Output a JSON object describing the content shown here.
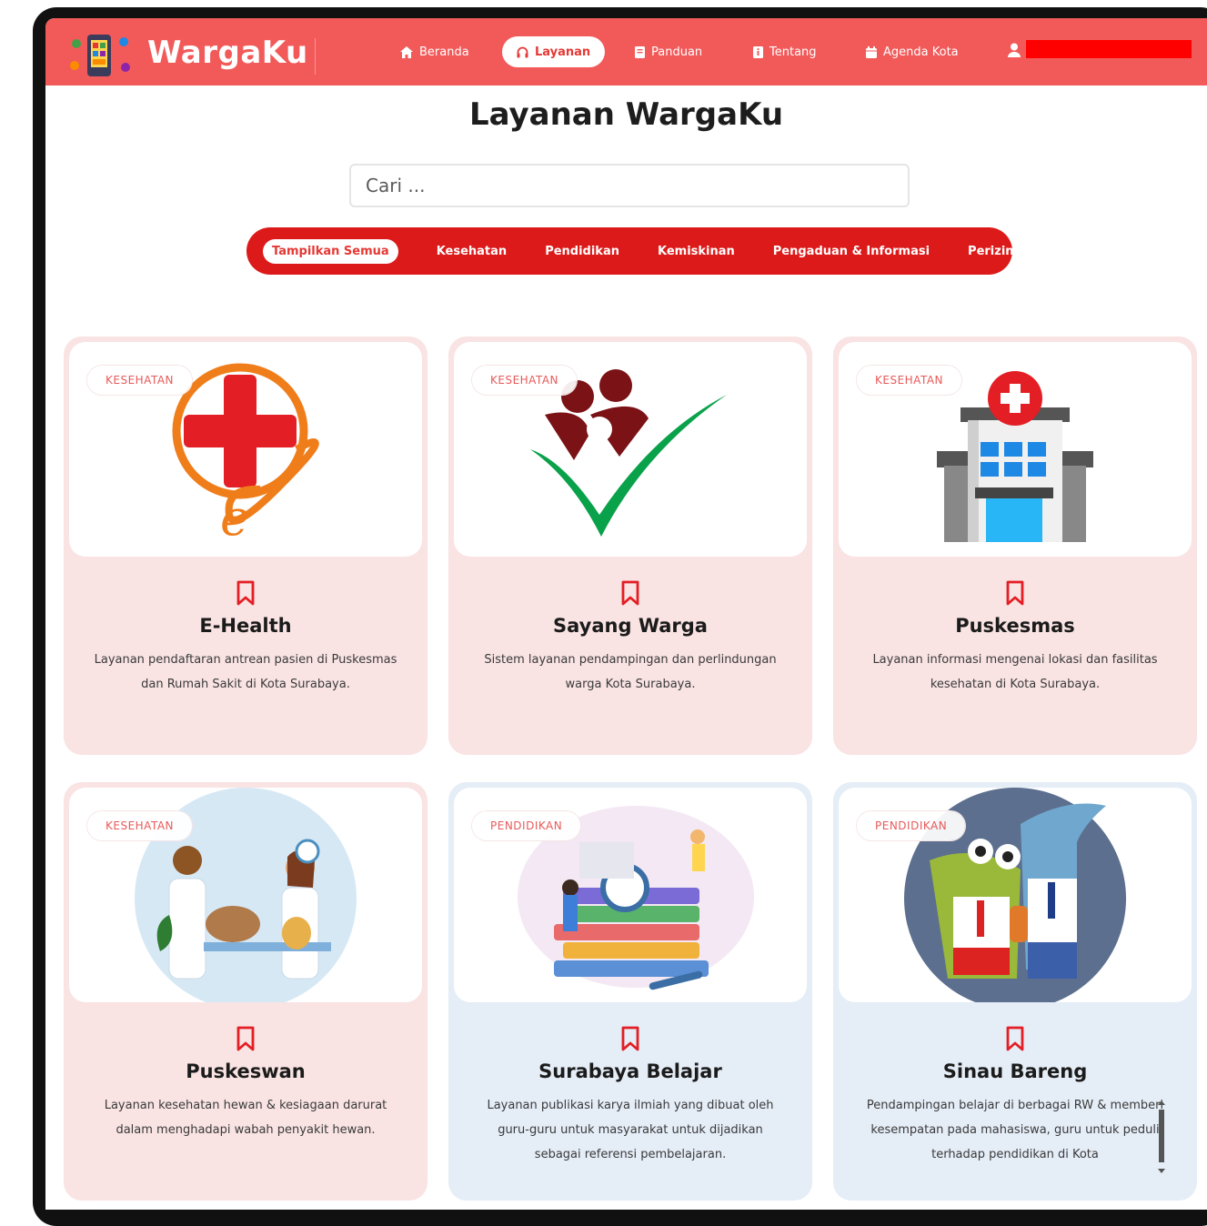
{
  "nav": {
    "brand": "WargaKu",
    "items": [
      {
        "label": "Beranda",
        "icon": "home-icon"
      },
      {
        "label": "Layanan",
        "icon": "headset-icon",
        "active": true
      },
      {
        "label": "Panduan",
        "icon": "book-icon"
      },
      {
        "label": "Tentang",
        "icon": "info-book-icon"
      },
      {
        "label": "Agenda Kota",
        "icon": "calendar-icon"
      }
    ]
  },
  "page": {
    "title": "Layanan WargaKu",
    "search_placeholder": "Cari ..."
  },
  "filters": [
    "Tampilkan Semua",
    "Kesehatan",
    "Pendidikan",
    "Kemiskinan",
    "Pengaduan & Informasi",
    "Perizinan"
  ],
  "cards": [
    {
      "badge": "KESEHATAN",
      "title": "E-Health",
      "desc": "Layanan pendaftaran antrean pasien di Puskesmas dan Rumah Sakit di Kota Surabaya."
    },
    {
      "badge": "KESEHATAN",
      "title": "Sayang Warga",
      "desc": "Sistem layanan pendampingan dan perlindungan warga Kota Surabaya."
    },
    {
      "badge": "KESEHATAN",
      "title": "Puskesmas",
      "desc": "Layanan informasi mengenai lokasi dan fasilitas kesehatan di Kota Surabaya."
    },
    {
      "badge": "KESEHATAN",
      "title": "Puskeswan",
      "desc": "Layanan kesehatan hewan & kesiagaan darurat dalam menghadapi wabah penyakit hewan."
    },
    {
      "badge": "PENDIDIKAN",
      "title": "Surabaya Belajar",
      "desc": "Layanan publikasi karya ilmiah yang dibuat oleh guru-guru untuk masyarakat untuk dijadikan sebagai referensi pembelajaran."
    },
    {
      "badge": "PENDIDIKAN",
      "title": "Sinau Bareng",
      "desc": "Pendampingan belajar di berbagai RW & memberi kesempatan pada mahasiswa, guru untuk peduli terhadap pendidikan di Kota"
    }
  ],
  "colors": {
    "primary": "#f25a5a",
    "accent": "#dc1a1a",
    "card_red": "#f9e3e3",
    "card_blue": "#e5edf7"
  }
}
